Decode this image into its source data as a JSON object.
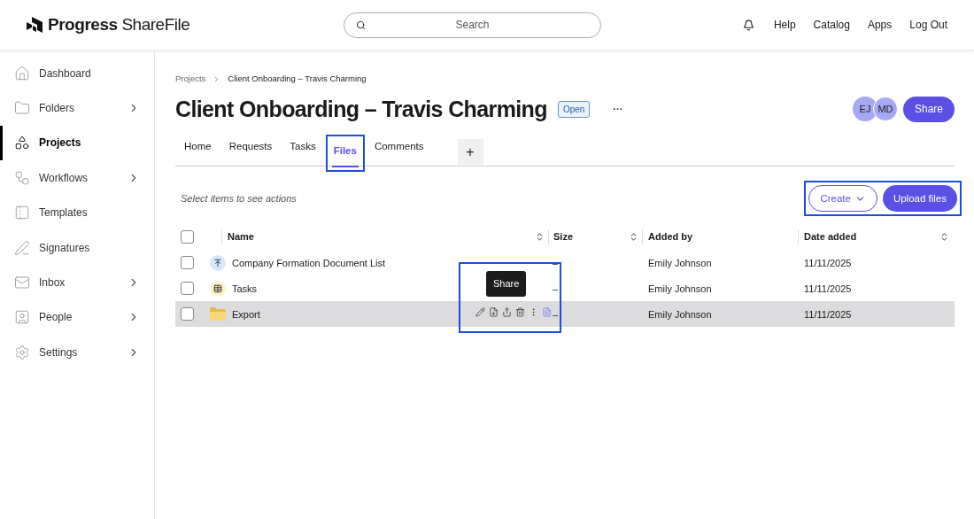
{
  "header": {
    "logo_bold": "Progress",
    "logo_light": "ShareFile",
    "search": {
      "placeholder": "Search"
    },
    "links": [
      "Help",
      "Catalog",
      "Apps",
      "Log Out"
    ]
  },
  "sidebar": {
    "items": [
      {
        "label": "Dashboard",
        "selected": false,
        "has_submenu": false
      },
      {
        "label": "Folders",
        "selected": false,
        "has_submenu": true
      },
      {
        "label": "Projects",
        "selected": true,
        "has_submenu": false
      },
      {
        "label": "Workflows",
        "selected": false,
        "has_submenu": true
      },
      {
        "label": "Templates",
        "selected": false,
        "has_submenu": false
      },
      {
        "label": "Signatures",
        "selected": false,
        "has_submenu": false
      },
      {
        "label": "Inbox",
        "selected": false,
        "has_submenu": true
      },
      {
        "label": "People",
        "selected": false,
        "has_submenu": true
      },
      {
        "label": "Settings",
        "selected": false,
        "has_submenu": true
      }
    ]
  },
  "breadcrumb": [
    "Projects",
    "Client Onboarding – Travis Charming"
  ],
  "title": "Client Onboarding – Travis Charming",
  "status_badge": "Open",
  "more": "···",
  "members": [
    "EJ",
    "MD"
  ],
  "share_button": "Share",
  "tabs": [
    {
      "label": "Home",
      "selected": false,
      "highlighted": false
    },
    {
      "label": "Requests",
      "selected": false,
      "highlighted": false
    },
    {
      "label": "Tasks",
      "selected": false,
      "highlighted": false
    },
    {
      "label": "Files",
      "selected": true,
      "highlighted": true
    },
    {
      "label": "Comments",
      "selected": false,
      "highlighted": false
    }
  ],
  "add_tab": "+",
  "hint": "Select items to see actions",
  "actions": {
    "create": "Create",
    "upload": "Upload files",
    "highlighted": true
  },
  "table": {
    "select_all_checked": false,
    "columns": [
      "Name",
      "Size",
      "Added by",
      "Date added"
    ],
    "rows": [
      {
        "kind": "request",
        "name": "Company Formation Document List",
        "size": "–",
        "added_by": "Emily Johnson",
        "date": "11/11/2025",
        "checked": false,
        "hovered": false
      },
      {
        "kind": "tasks",
        "name": "Tasks",
        "size": "–",
        "added_by": "Emily Johnson",
        "date": "11/11/2025",
        "checked": false,
        "hovered": false
      },
      {
        "kind": "folder",
        "name": "Export",
        "size": "–",
        "added_by": "Emily Johnson",
        "date": "11/11/2025",
        "checked": false,
        "hovered": true,
        "tooltip": "Share",
        "actions_highlighted": true
      }
    ]
  }
}
